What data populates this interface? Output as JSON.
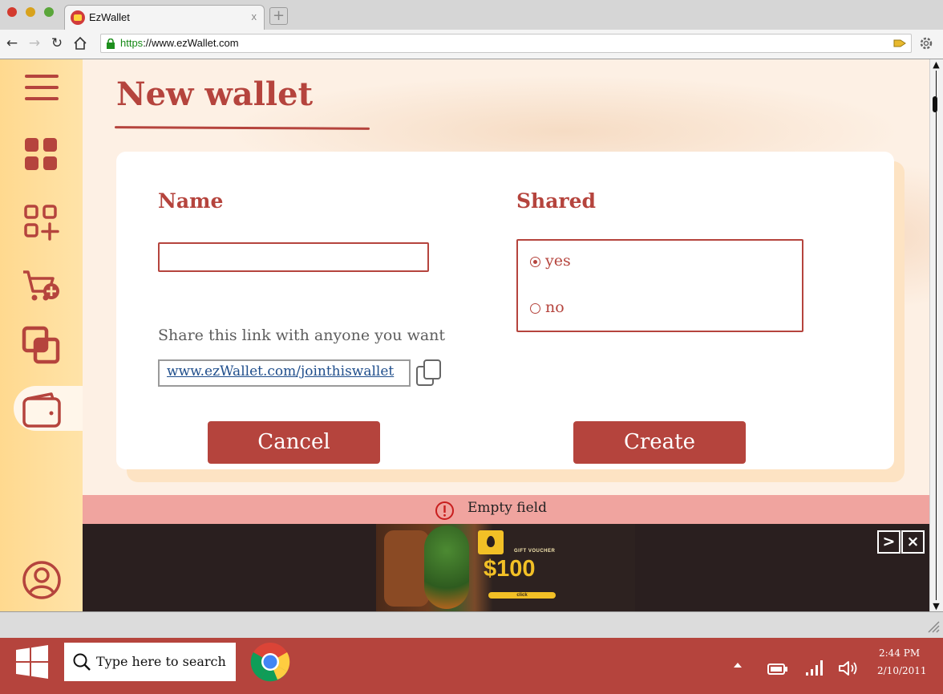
{
  "browser": {
    "tab_title": "EzWallet",
    "tab_close": "x",
    "new_tab": "+",
    "url_scheme": "https",
    "url_rest": "://www.ezWallet.com"
  },
  "sidebar": {
    "items": [
      {
        "name": "menu"
      },
      {
        "name": "dashboard"
      },
      {
        "name": "add-category"
      },
      {
        "name": "add-to-cart"
      },
      {
        "name": "transactions"
      },
      {
        "name": "wallet",
        "selected": true
      },
      {
        "name": "profile"
      }
    ]
  },
  "page": {
    "title": "New wallet",
    "name_label": "Name",
    "name_value": "",
    "shared_label": "Shared",
    "shared_options": [
      {
        "label": "yes",
        "selected": true
      },
      {
        "label": "no",
        "selected": false
      }
    ],
    "share_text": "Share this link with anyone you want",
    "share_link": "www.ezWallet.com/jointhiswallet",
    "cancel_label": "Cancel",
    "create_label": "Create"
  },
  "error": {
    "message": "Empty field"
  },
  "ad": {
    "gift_text": "GIFT VOUCHER",
    "amount": "$100",
    "click_text": "click",
    "next_label": ">",
    "close_label": "×"
  },
  "taskbar": {
    "search_placeholder": "Type here to search",
    "time": "2:44 PM",
    "date": "2/10/2011"
  },
  "colors": {
    "accent": "#b5443d",
    "sidebar": "#ffd98f",
    "error_bg": "#f0a49f"
  }
}
